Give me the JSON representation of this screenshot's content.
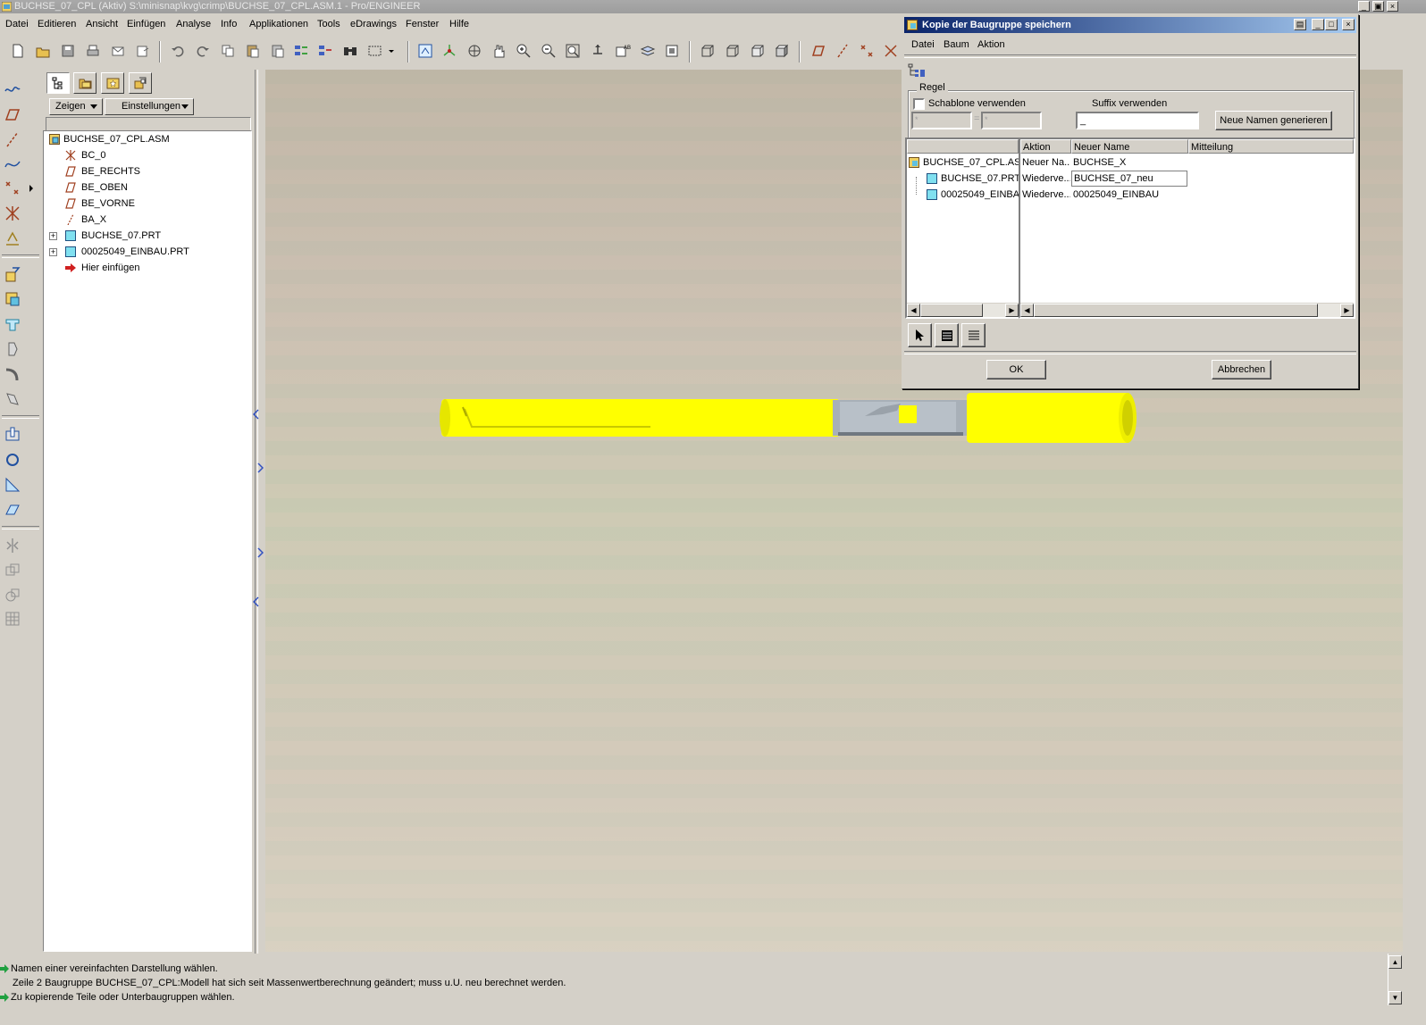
{
  "window": {
    "title": "BUCHSE_07_CPL (Aktiv) S:\\minisnap\\kvg\\crimp\\BUCHSE_07_CPL.ASM.1 - Pro/ENGINEER"
  },
  "menu": [
    "Datei",
    "Editieren",
    "Ansicht",
    "Einfügen",
    "Analyse",
    "Info",
    "Applikationen",
    "Tools",
    "eDrawings",
    "Fenster",
    "Hilfe"
  ],
  "navigator": {
    "show_label": "Zeigen",
    "settings_label": "Einstellungen"
  },
  "tree": {
    "items": [
      "BUCHSE_07_CPL.ASM",
      "BC_0",
      "BE_RECHTS",
      "BE_OBEN",
      "BE_VORNE",
      "BA_X",
      "BUCHSE_07.PRT",
      "00025049_EINBAU.PRT",
      "Hier einfügen"
    ]
  },
  "dialog": {
    "title": "Kopie der Baugruppe speichern",
    "menu": [
      "Datei",
      "Baum",
      "Aktion"
    ],
    "rule_group": "Regel",
    "template_checkbox": "Schablone verwenden",
    "template_checked": false,
    "template_from": "*",
    "template_eq": "=",
    "template_to": "*",
    "suffix_label": "Suffix verwenden",
    "suffix_value": "_",
    "generate_button": "Neue Namen generieren",
    "columns": {
      "action": "Aktion",
      "new_name": "Neuer Name",
      "message": "Mitteilung"
    },
    "rows": [
      {
        "name": "BUCHSE_07_CPL.AS",
        "action": "Neuer Na...",
        "new_name": "BUCHSE_X"
      },
      {
        "name": "BUCHSE_07.PRT",
        "action": "Wiederve...",
        "new_name": "BUCHSE_07_neu"
      },
      {
        "name": "00025049_EINBA",
        "action": "Wiederve...",
        "new_name": "00025049_EINBAU"
      }
    ],
    "ok_button": "OK",
    "cancel_button": "Abbrechen"
  },
  "status": [
    "Namen einer vereinfachten Darstellung wählen.",
    "Zeile 2 Baugruppe BUCHSE_07_CPL:Modell hat sich seit Massenwertberechnung geändert; muss u.U. neu berechnet werden.",
    "Zu kopierende Teile oder Unterbaugruppen wählen."
  ],
  "colors": {
    "part_yellow": "#ffff00",
    "part_gray": "#a8b0b8",
    "dialog_title": "#0a246a"
  }
}
